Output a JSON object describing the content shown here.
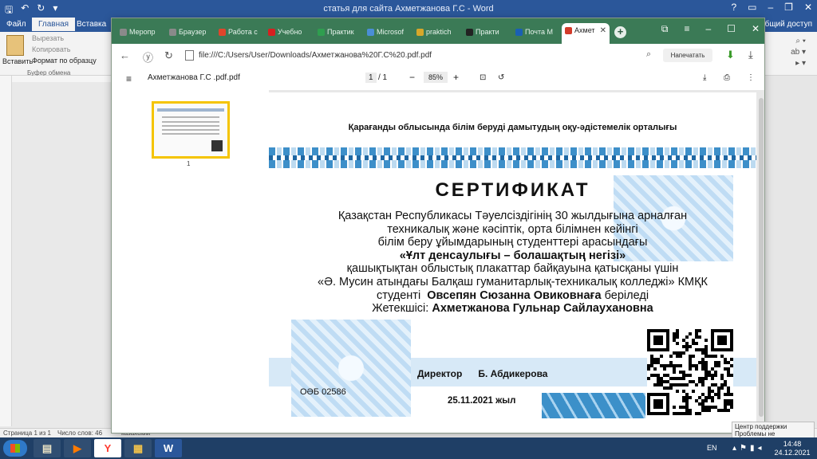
{
  "word": {
    "title": "статья для сайта Ахметжанова Г.С - Word",
    "tabs": [
      "Файл",
      "Главная",
      "Вставка"
    ],
    "share": "Общий доступ",
    "clipboard": {
      "paste": "Вставить",
      "cut": "Вырезать",
      "copy": "Копировать",
      "format_painter": "Формат по образцу",
      "group_label": "Буфер обмена"
    },
    "status": {
      "page": "Страница 1 из 1",
      "words": "Число слов: 46",
      "lang": "казахский"
    }
  },
  "browser": {
    "tabs": [
      {
        "label": "Меропр",
        "color": "#8a8a8a"
      },
      {
        "label": "Браузер",
        "color": "#8a8a8a"
      },
      {
        "label": "Работа с",
        "color": "#e0452b"
      },
      {
        "label": "Учебно",
        "color": "#d62020"
      },
      {
        "label": "Практик",
        "color": "#2f9e4f"
      },
      {
        "label": "Microsof",
        "color": "#4a8ed6"
      },
      {
        "label": "praktich",
        "color": "#d7a72a"
      },
      {
        "label": "Практи",
        "color": "#222222"
      },
      {
        "label": "Почта М",
        "color": "#1a5fb4"
      }
    ],
    "active_tab": {
      "label": "Ахмет",
      "color": "#d23b2a"
    },
    "new_tab": "+",
    "address": "file:///C:/Users/User/Downloads/Ахметжанова%20Г.С%20.pdf.pdf",
    "translate": "Напечатать"
  },
  "pdf": {
    "filename": "Ахметжанова Г.С .pdf.pdf",
    "page_current": "1",
    "page_total": "/ 1",
    "zoom": "85%",
    "thumb_number": "1"
  },
  "certificate": {
    "org": "Қарағанды облысында білім беруді дамытудың оқу-әдістемелік орталығы",
    "title": "СЕРТИФИКАТ",
    "line1": "Қазақстан Республикасы Тәуелсіздігінің 30 жылдығына арналған",
    "line2": "техникалық және кәсіптік, орта білімнен кейінгі",
    "line3": "білім беру ұйымдарының студенттері арасындағы",
    "line4": "«Ұлт денсаулығы – болашақтың негізі»",
    "line5": "қашықтықтан облыстық плакаттар байқауына қатысқаны үшін",
    "line6": "«Ә. Мусин атындағы Балқаш гуманитарлық-техникалық колледжі» КМҚК",
    "line7_prefix": "студенті",
    "student": "Овсепян Сюзанна Овиковнаға",
    "line7_suffix": "беріледі",
    "supervisor_label": "Жетекшісі:",
    "supervisor": "Ахметжанова Гульнар Сайлаухановна",
    "director_title": "Директор",
    "director_name": "Б. Абдикерова",
    "code": "ОӘБ 02586",
    "date": "25.11.2021 жыл"
  },
  "taskbar": {
    "lang": "EN",
    "time": "14:48",
    "date": "24.12.2021",
    "notification_line1": "Центр поддержки",
    "notification_line2": "Проблемы не обнаружены"
  }
}
